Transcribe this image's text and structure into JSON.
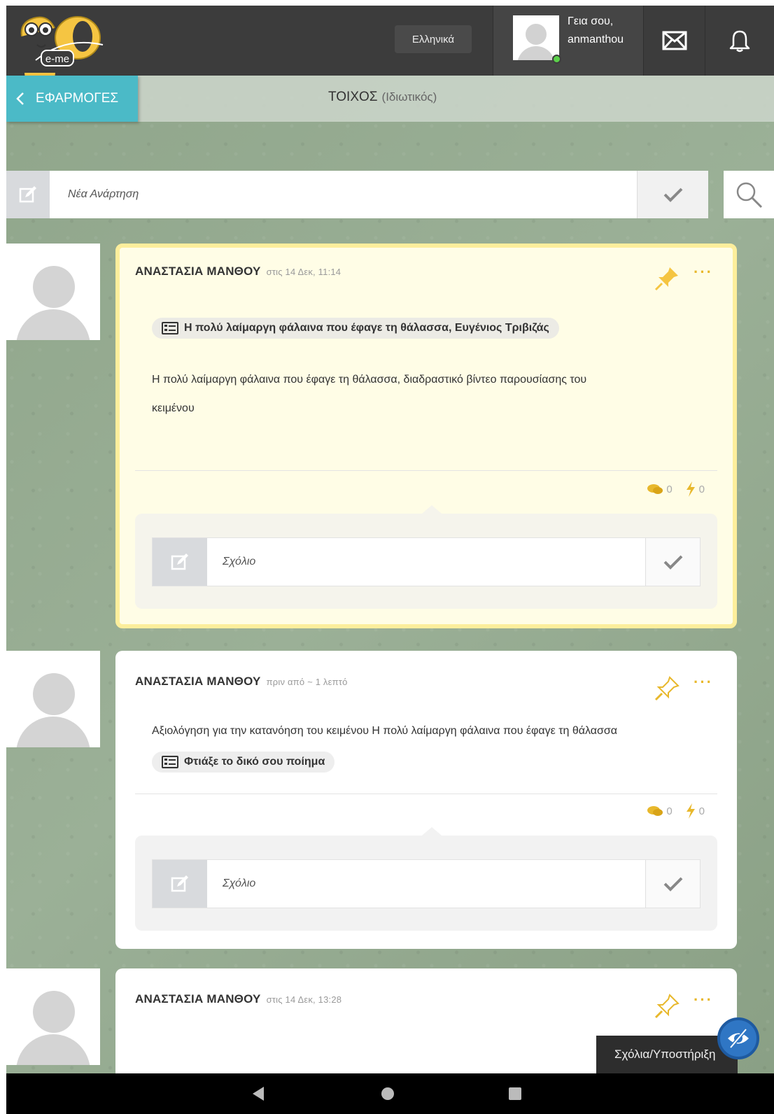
{
  "header": {
    "logo_text": "e-me",
    "language_label": "Ελληνικά",
    "greeting_line1": "Γεια σου,",
    "greeting_line2": "anmanthou"
  },
  "subheader": {
    "apps_label": "ΕΦΑΡΜΟΓΕΣ",
    "title": "ΤΟΙΧΟΣ",
    "subtitle": "(Ιδιωτικός)"
  },
  "new_post": {
    "placeholder": "Νέα Ανάρτηση"
  },
  "posts": [
    {
      "author": "ΑΝΑΣΤΑΣΙΑ ΜΑΝΘΟΥ",
      "time": "στις 14 Δεκ, 11:14",
      "pinned": true,
      "chip": "Η πολύ λαίμαργη φάλαινα που έφαγε τη θάλασσα, Ευγένιος Τριβιζάς",
      "body_line1": "Η πολύ λαίμαργη φάλαινα που έφαγε τη θάλασσα, διαδραστικό βίντεο παρουσίασης του",
      "body_line2": "κειμένου",
      "comments_count": "0",
      "likes_count": "0",
      "comment_placeholder": "Σχόλιο"
    },
    {
      "author": "ΑΝΑΣΤΑΣΙΑ ΜΑΝΘΟΥ",
      "time": "πριν από ~ 1 λεπτό",
      "pinned": false,
      "body_line1": "Αξιολόγηση για την κατανόηση του κειμένου Η πολύ λαίμαργη φάλαινα που έφαγε τη θάλασσα",
      "chip": "Φτιάξε το δικό σου ποίημα",
      "comments_count": "0",
      "likes_count": "0",
      "comment_placeholder": "Σχόλιο"
    },
    {
      "author": "ΑΝΑΣΤΑΣΙΑ ΜΑΝΘΟΥ",
      "time": "στις 14 Δεκ, 13:28",
      "pinned": false
    }
  ],
  "feedback": {
    "label": "Σχόλια/Υποστήριξη"
  },
  "colors": {
    "topbar": "#3c3c3c",
    "accent_teal": "#4bbac7",
    "pin_yellow": "#f5c542",
    "pinned_border": "#fcee9c",
    "background_green": "#90a58c"
  }
}
